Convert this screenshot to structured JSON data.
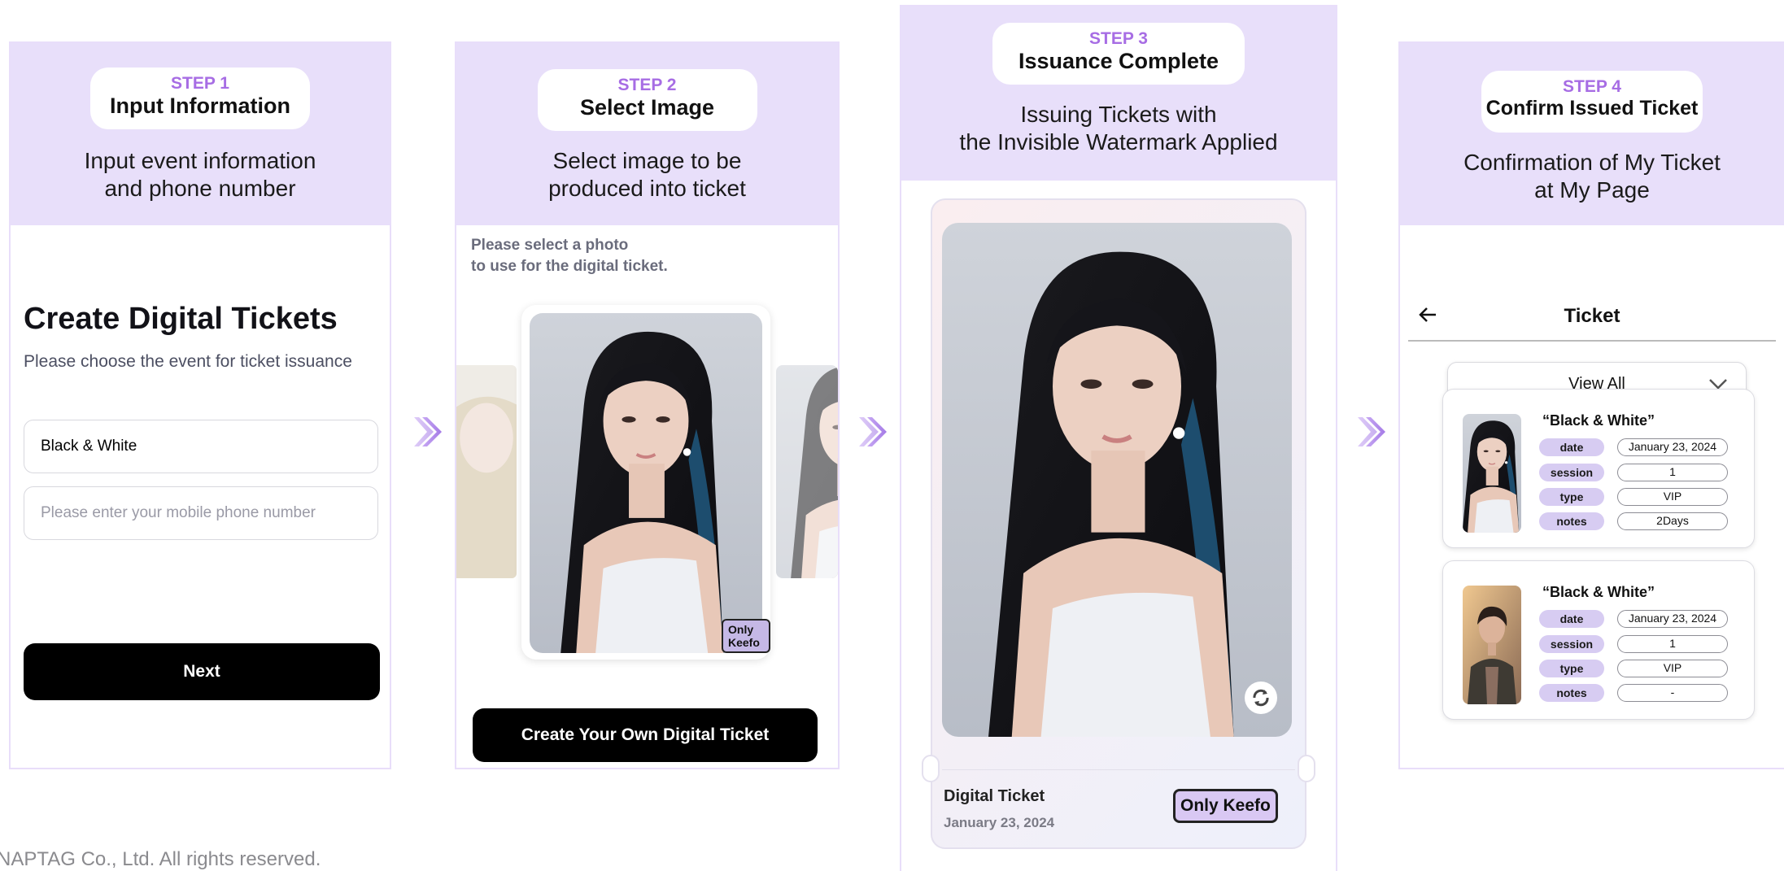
{
  "steps": [
    {
      "step": "STEP 1",
      "title": "Input Information",
      "desc_line1": "Input event information",
      "desc_line2": "and phone number"
    },
    {
      "step": "STEP 2",
      "title": "Select Image",
      "desc_line1": "Select image to be",
      "desc_line2": "produced into ticket"
    },
    {
      "step": "STEP 3",
      "title": "Issuance Complete",
      "desc_line1": "Issuing Tickets with",
      "desc_line2": "the Invisible Watermark Applied"
    },
    {
      "step": "STEP 4",
      "title": "Confirm Issued Ticket",
      "desc_line1": "Confirmation of My Ticket",
      "desc_line2": "at My Page"
    }
  ],
  "step1": {
    "heading": "Create Digital Tickets",
    "subheading": "Please choose the event for ticket issuance",
    "event_value": "Black & White",
    "phone_placeholder": "Please enter your mobile phone number",
    "next_label": "Next"
  },
  "step2": {
    "hint_line1": "Please select a photo",
    "hint_line2": "to use for the digital ticket.",
    "watermark_badge": "Only Keefo",
    "create_label": "Create Your Own Digital Ticket"
  },
  "step3": {
    "ticket_name": "Digital Ticket",
    "ticket_date": "January 23, 2024",
    "watermark_badge": "Only Keefo"
  },
  "step4": {
    "header_title": "Ticket",
    "filter_value": "View All",
    "tickets": [
      {
        "name": "“Black & White”",
        "rows": [
          {
            "label": "date",
            "value": "January 23, 2024"
          },
          {
            "label": "session",
            "value": "1"
          },
          {
            "label": "type",
            "value": "VIP"
          },
          {
            "label": "notes",
            "value": "2Days"
          }
        ]
      },
      {
        "name": "“Black & White”",
        "rows": [
          {
            "label": "date",
            "value": "January 23, 2024"
          },
          {
            "label": "session",
            "value": "1"
          },
          {
            "label": "type",
            "value": "VIP"
          },
          {
            "label": "notes",
            "value": "-"
          }
        ]
      }
    ]
  },
  "footer": "NAPTAG Co., Ltd. All rights reserved.",
  "colors": {
    "accent": "#a76de4",
    "panel_header": "#e8dffa",
    "button": "#000000",
    "label_pill": "#d7ccf2"
  }
}
